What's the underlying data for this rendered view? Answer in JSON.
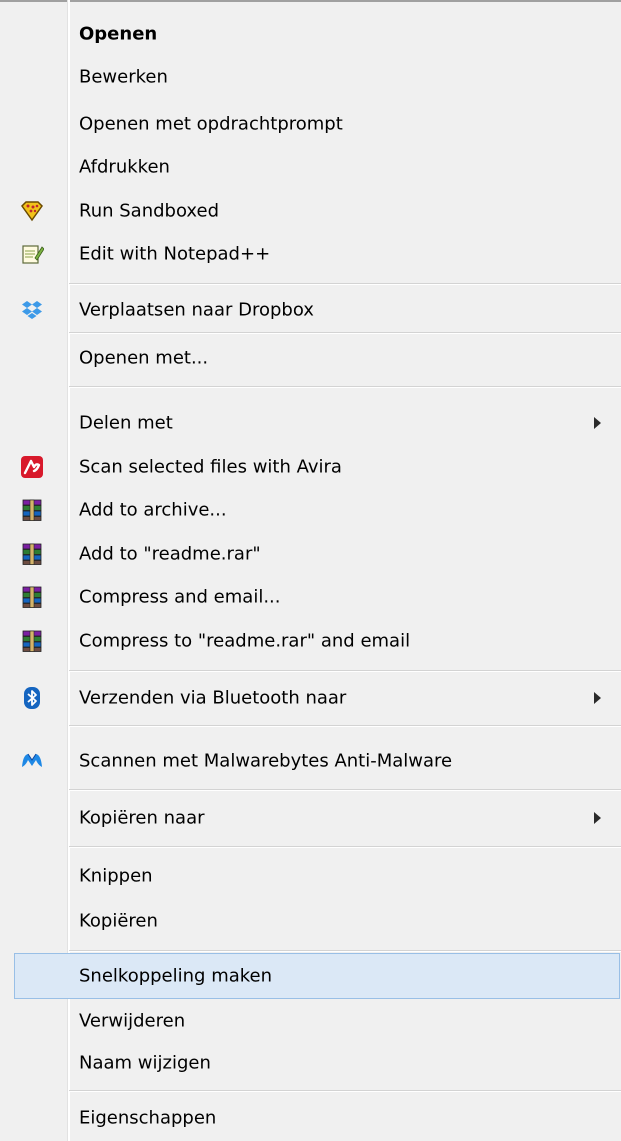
{
  "menu": {
    "items": [
      {
        "label": "Openen"
      },
      {
        "label": "Bewerken"
      },
      {
        "label": "Openen met opdrachtprompt"
      },
      {
        "label": "Afdrukken"
      },
      {
        "label": "Run Sandboxed",
        "icon": "sandboxie-icon"
      },
      {
        "label": "Edit with Notepad++",
        "icon": "notepad-plus-plus-icon"
      },
      {
        "label": "Verplaatsen naar Dropbox",
        "icon": "dropbox-icon"
      },
      {
        "label": "Openen met..."
      },
      {
        "label": "Delen met"
      },
      {
        "label": "Scan selected files with Avira",
        "icon": "avira-icon"
      },
      {
        "label": "Add to archive...",
        "icon": "winrar-icon"
      },
      {
        "label": "Add to \"readme.rar\"",
        "icon": "winrar-icon"
      },
      {
        "label": "Compress and email...",
        "icon": "winrar-icon"
      },
      {
        "label": "Compress to \"readme.rar\" and email",
        "icon": "winrar-icon"
      },
      {
        "label": "Verzenden via Bluetooth naar",
        "icon": "bluetooth-icon"
      },
      {
        "label": "Scannen met Malwarebytes Anti-Malware",
        "icon": "malwarebytes-icon"
      },
      {
        "label": "Kopiëren naar"
      },
      {
        "label": "Knippen"
      },
      {
        "label": "Kopiëren"
      },
      {
        "label": "Snelkoppeling maken"
      },
      {
        "label": "Verwijderen"
      },
      {
        "label": "Naam wijzigen"
      },
      {
        "label": "Eigenschappen"
      }
    ],
    "default_item": "Openen",
    "highlighted_item": "Snelkoppeling maken",
    "submenu_items": [
      "Delen met",
      "Verzenden via Bluetooth naar",
      "Kopiëren naar"
    ],
    "colors": {
      "background": "#f0f0f0",
      "highlight_fill": "#dbe8f6",
      "highlight_border": "#99bfe6",
      "separator": "#d3d3d3"
    }
  }
}
